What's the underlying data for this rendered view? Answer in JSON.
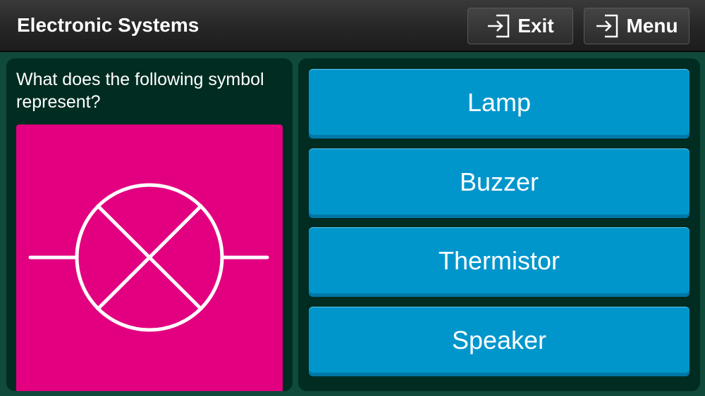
{
  "header": {
    "title": "Electronic Systems",
    "exit_label": "Exit",
    "menu_label": "Menu"
  },
  "question": {
    "text": "What does the following symbol represent?",
    "symbol_icon": "lamp-symbol-icon",
    "symbol_background": "#e20080"
  },
  "answers": [
    {
      "label": "Lamp"
    },
    {
      "label": "Buzzer"
    },
    {
      "label": "Thermistor"
    },
    {
      "label": "Speaker"
    }
  ],
  "colors": {
    "background": "#0f4a3a",
    "panel": "#012c22",
    "answer_button": "#0096cc",
    "header": "#2b2b2b"
  }
}
